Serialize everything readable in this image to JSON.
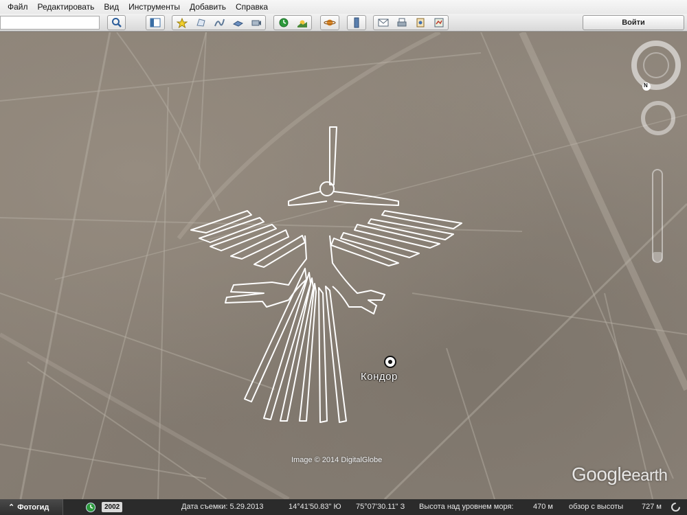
{
  "menu": [
    {
      "label": "Файл"
    },
    {
      "label": "Редактировать"
    },
    {
      "label": "Вид"
    },
    {
      "label": "Инструменты"
    },
    {
      "label": "Добавить"
    },
    {
      "label": "Справка"
    }
  ],
  "toolbar": {
    "search_value": "",
    "sign_in_label": "Войти"
  },
  "map": {
    "place_label": "Кондор",
    "copyright": "Image © 2014 DigitalGlobe",
    "logo_google": "Google",
    "logo_earth": "earth",
    "compass_north": "N"
  },
  "status": {
    "tour_label": "Фотогид",
    "year": "2002",
    "imagery_date": "Дата съемки: 5.29.2013",
    "latitude": "14°41'50.83\" Ю",
    "longitude": "75°07'30.11\" З",
    "elevation": "Высота над уровнем моря:",
    "elevation_value": "470 м",
    "eye_alt_label": "обзор с высоты",
    "eye_alt_value": "727 м"
  },
  "colors": {
    "menubar_bg": "#eeeeee",
    "statusbar_bg": "#2b2b2b",
    "ground": "#8a8176",
    "outline": "#ffffff"
  }
}
